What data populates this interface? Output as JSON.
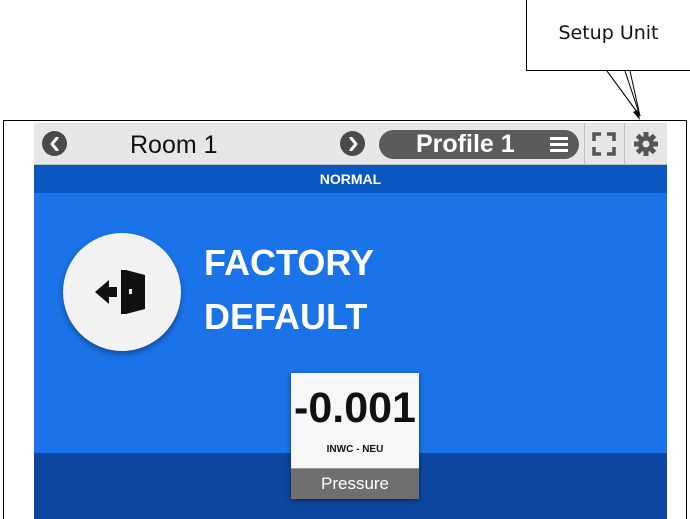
{
  "callout": {
    "label": "Setup Unit"
  },
  "topbar": {
    "prev_icon": "chevron-left-icon",
    "room_label": "Room 1",
    "next_icon": "chevron-right-icon",
    "profile_label": "Profile 1",
    "menu_icon": "hamburger-menu-icon",
    "fullscreen_icon": "fullscreen-icon",
    "settings_icon": "gear-icon"
  },
  "status": {
    "label": "NORMAL"
  },
  "mode": {
    "icon": "exit-door-icon",
    "line1": "FACTORY",
    "line2": "DEFAULT"
  },
  "pressure_card": {
    "value": "-0.001",
    "unit": "INWC - NEU",
    "name": "Pressure"
  },
  "colors": {
    "background_blue": "#1a73e8",
    "status_blue": "#0a57c2",
    "bottom_blue": "#0d47a1",
    "topbar_gray": "#e6e6e6",
    "pill_gray": "#5b5b5b"
  }
}
